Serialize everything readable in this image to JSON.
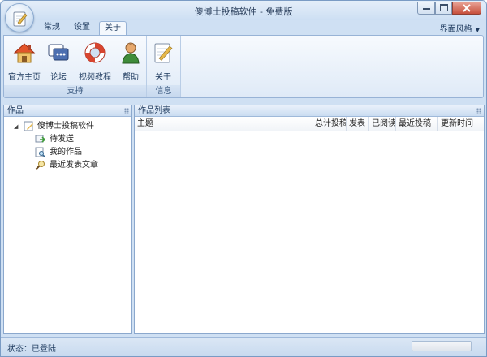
{
  "window": {
    "title": "傻博士投稿软件 - 免费版"
  },
  "tabs": [
    {
      "label": "常规"
    },
    {
      "label": "设置"
    },
    {
      "label": "关于",
      "active": true
    }
  ],
  "style_menu": {
    "label": "界面风格"
  },
  "ribbon": {
    "groups": [
      {
        "label": "支持",
        "buttons": [
          {
            "label": "官方主页",
            "icon": "home-icon"
          },
          {
            "label": "论坛",
            "icon": "forum-icon"
          },
          {
            "label": "视频教程",
            "icon": "lifebuoy-icon"
          },
          {
            "label": "帮助",
            "icon": "help-person-icon"
          }
        ]
      },
      {
        "label": "信息",
        "buttons": [
          {
            "label": "关于",
            "icon": "notepad-icon"
          }
        ]
      }
    ]
  },
  "left_pane": {
    "title": "作品",
    "tree": {
      "root": {
        "label": "傻博士投稿软件",
        "expanded": true
      },
      "children": [
        {
          "label": "待发送",
          "icon": "send-icon"
        },
        {
          "label": "我的作品",
          "icon": "document-search-icon"
        },
        {
          "label": "最近发表文章",
          "icon": "magnifier-icon"
        }
      ]
    }
  },
  "right_pane": {
    "title": "作品列表",
    "columns": [
      "主题",
      "总计投稿",
      "发表",
      "已阅读",
      "最近投稿",
      "更新时间"
    ],
    "rows": []
  },
  "status": {
    "text": "状态：已登陆",
    "progress": 0
  },
  "colors": {
    "accent": "#cfe0f3",
    "border": "#8ba8cd"
  }
}
